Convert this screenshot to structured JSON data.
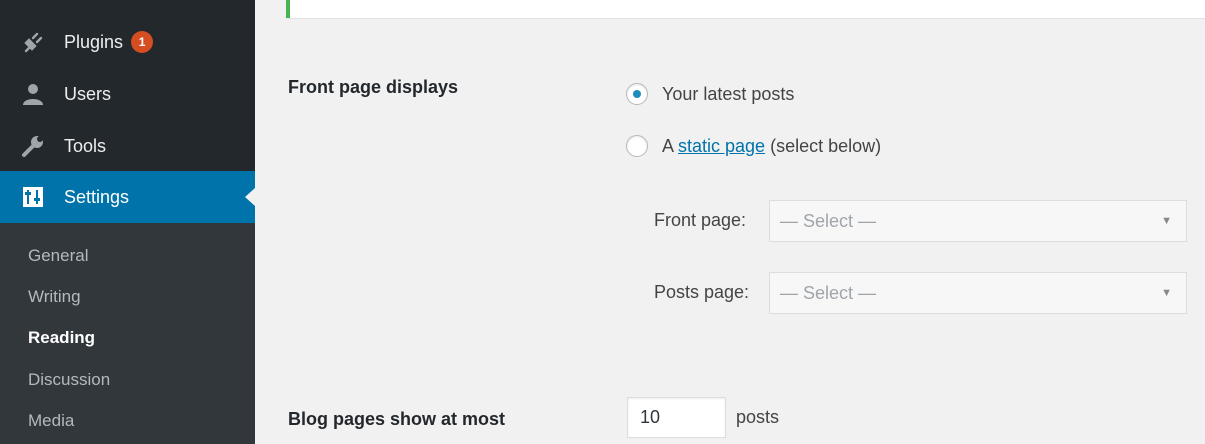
{
  "sidebar": {
    "menu": [
      {
        "label": "Plugins",
        "badge": "1",
        "icon": "plugin-icon"
      },
      {
        "label": "Users",
        "icon": "users-icon"
      },
      {
        "label": "Tools",
        "icon": "wrench-icon"
      },
      {
        "label": "Settings",
        "icon": "settings-icon",
        "current": true
      }
    ],
    "submenu": [
      {
        "label": "General"
      },
      {
        "label": "Writing"
      },
      {
        "label": "Reading",
        "current": true
      },
      {
        "label": "Discussion"
      },
      {
        "label": "Media"
      }
    ]
  },
  "reading": {
    "front_page_displays": {
      "label": "Front page displays",
      "option_latest": "Your latest posts",
      "option_static_prefix": "A ",
      "option_static_link": "static page",
      "option_static_suffix": " (select below)",
      "selected": "latest"
    },
    "front_page": {
      "label": "Front page:",
      "value": "— Select —"
    },
    "posts_page": {
      "label": "Posts page:",
      "value": "— Select —"
    },
    "blog_pages": {
      "label": "Blog pages show at most",
      "value": "10",
      "suffix": "posts"
    }
  },
  "colors": {
    "sidebar_bg": "#23282d",
    "submenu_bg": "#32373c",
    "accent": "#0073aa",
    "badge": "#d54e21",
    "notice_border": "#46b450"
  }
}
